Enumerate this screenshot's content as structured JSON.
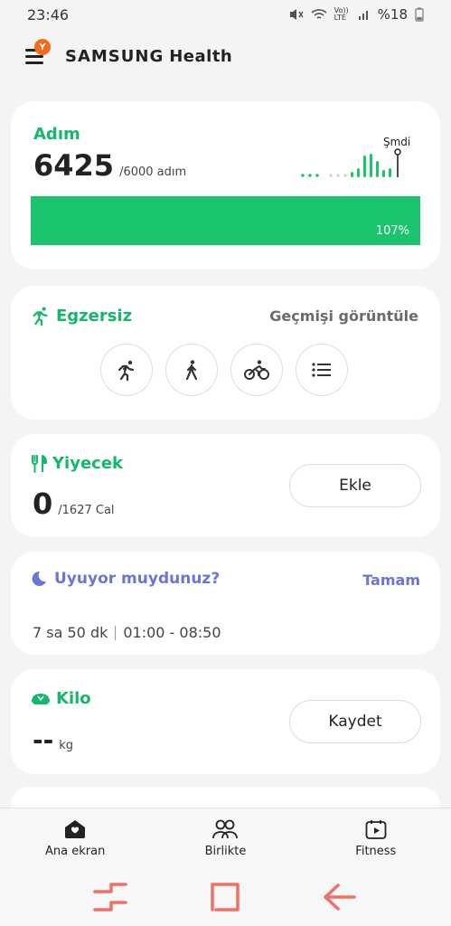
{
  "status_bar": {
    "time": "23:46",
    "network": "Vo)) LTE",
    "battery": "%18"
  },
  "app": {
    "brand": "SAMSUNG",
    "brand_suffix": "Health",
    "notification_badge": "Y"
  },
  "steps": {
    "title": "Adım",
    "value": "6425",
    "target": "/6000 adım",
    "progress_label": "107%",
    "progress": 1.07,
    "now_label": "Şmdi",
    "accent_color": "#1ac56e"
  },
  "exercise": {
    "title": "Egzersiz",
    "history_link": "Geçmişi görüntüle",
    "quick_buttons": [
      "running-icon",
      "walking-icon",
      "cycling-icon",
      "list-icon"
    ]
  },
  "food": {
    "title": "Yiyecek",
    "value": "0",
    "target": "/1627 Cal",
    "add_button": "Ekle"
  },
  "sleep": {
    "title": "Uyuyor muydunuz?",
    "confirm": "Tamam",
    "duration": "7 sa 50 dk",
    "range": "01:00 - 08:50",
    "accent_color": "#6b74d8"
  },
  "weight": {
    "title": "Kilo",
    "value": "--",
    "unit": "kg",
    "save_button": "Kaydet"
  },
  "bottom_nav": {
    "items": [
      {
        "label": "Ana ekran",
        "icon": "home-icon"
      },
      {
        "label": "Birlikte",
        "icon": "people-icon"
      },
      {
        "label": "Fitness",
        "icon": "fitness-icon"
      }
    ]
  },
  "system_nav": {
    "color": "#f07068"
  }
}
